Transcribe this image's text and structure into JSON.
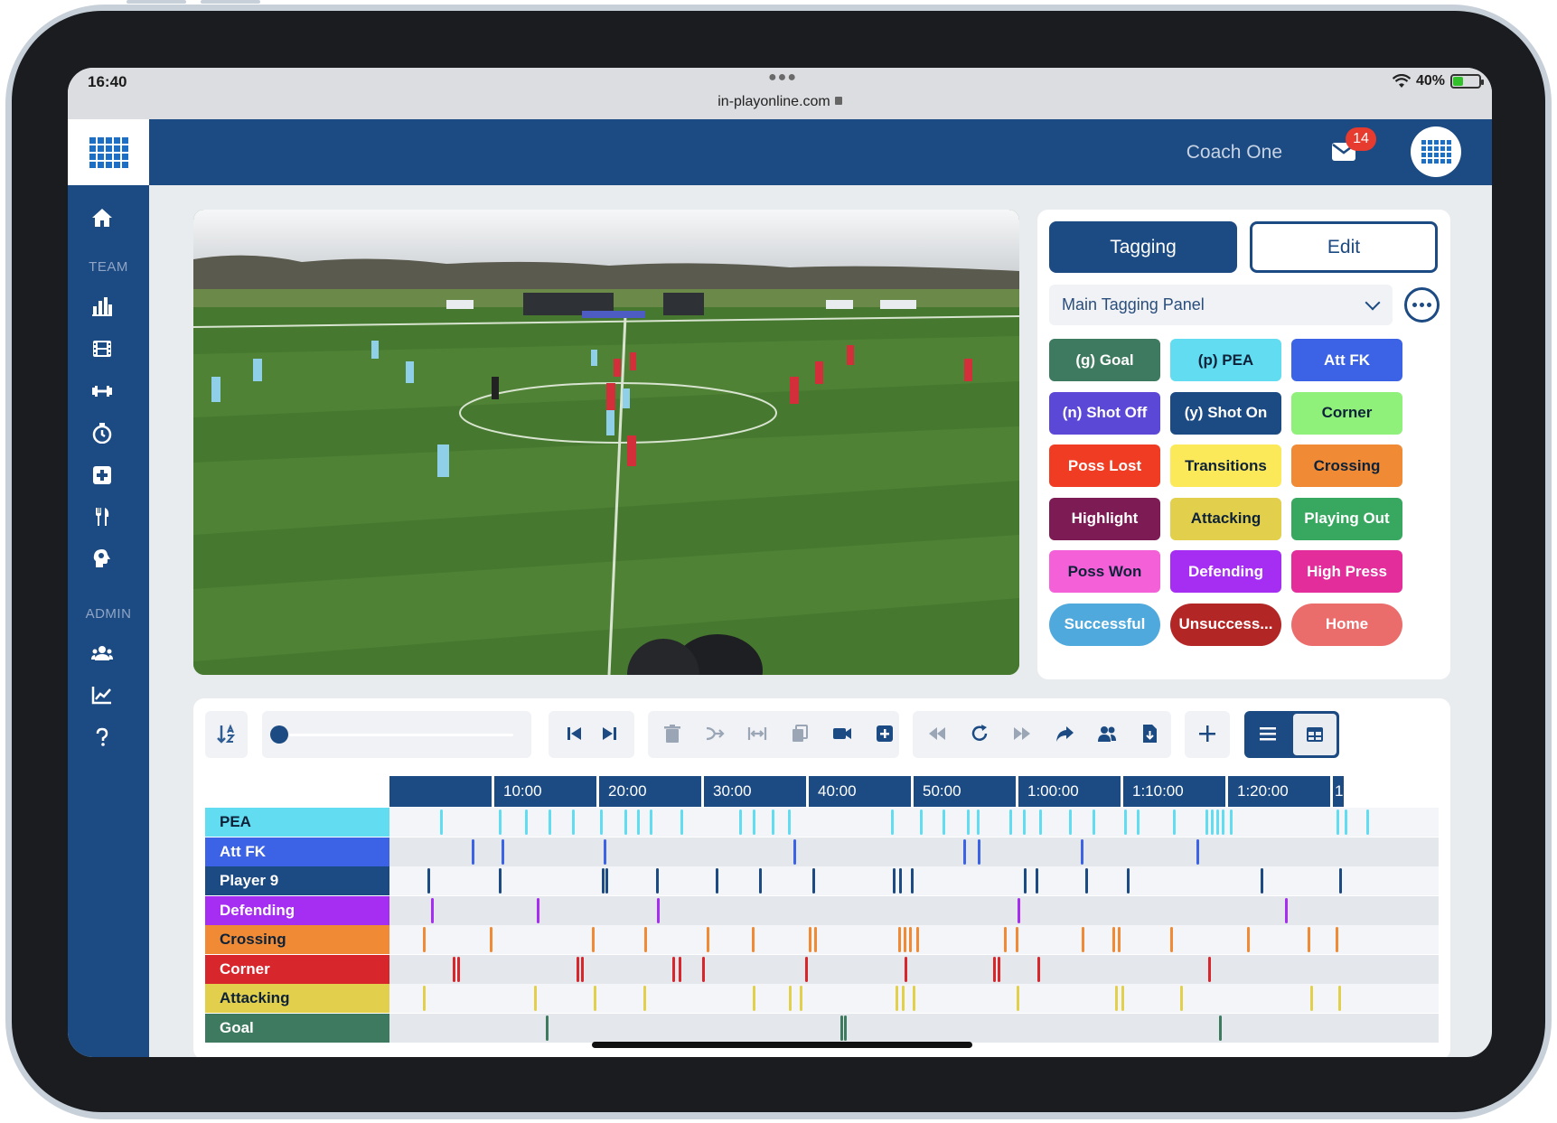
{
  "status_bar": {
    "time": "16:40",
    "url": "in-playonline.com",
    "battery": "40%",
    "battery_level": 0.4
  },
  "header": {
    "user_name": "Coach One",
    "notification_count": "14"
  },
  "sidebar": {
    "team_label": "TEAM",
    "admin_label": "ADMIN",
    "team_icons": [
      "home-icon",
      "bar-chart-icon",
      "film-icon",
      "dumbbell-icon",
      "stopwatch-icon",
      "medical-cross-icon",
      "fork-knife-icon",
      "brain-icon"
    ],
    "admin_icons": [
      "users-icon",
      "line-chart-icon",
      "help-icon"
    ]
  },
  "tagging": {
    "tagging_tab": "Tagging",
    "edit_tab": "Edit",
    "panel_name": "Main Tagging Panel",
    "buttons": [
      {
        "label": "(g) Goal",
        "color": "#3d7a5f",
        "text": "#ffffff"
      },
      {
        "label": "(p) PEA",
        "color": "#62dcf1",
        "text": "#0d2238"
      },
      {
        "label": "Att FK",
        "color": "#3c63e6",
        "text": "#ffffff"
      },
      {
        "label": "(n) Shot Off",
        "color": "#5b48d6",
        "text": "#ffffff"
      },
      {
        "label": "(y) Shot On",
        "color": "#1c4a82",
        "text": "#ffffff"
      },
      {
        "label": "Corner",
        "color": "#8ff07a",
        "text": "#0d2238"
      },
      {
        "label": "Poss Lost",
        "color": "#ef3c22",
        "text": "#ffffff"
      },
      {
        "label": "Transitions",
        "color": "#fbe95a",
        "text": "#0d2238"
      },
      {
        "label": "Crossing",
        "color": "#f08a35",
        "text": "#0d2238"
      },
      {
        "label": "Highlight",
        "color": "#7d1b55",
        "text": "#ffffff"
      },
      {
        "label": "Attacking",
        "color": "#e2cf4c",
        "text": "#0d2238"
      },
      {
        "label": "Playing Out",
        "color": "#38a860",
        "text": "#ffffff"
      },
      {
        "label": "Poss Won",
        "color": "#f460d8",
        "text": "#0d2238"
      },
      {
        "label": "Defending",
        "color": "#a52ef2",
        "text": "#ffffff"
      },
      {
        "label": "High Press",
        "color": "#e22d9a",
        "text": "#ffffff"
      },
      {
        "label": "Successful",
        "color": "#4fa9dc",
        "text": "#ffffff",
        "pill": true
      },
      {
        "label": "Unsuccess...",
        "color": "#b32626",
        "text": "#ffffff",
        "pill": true
      },
      {
        "label": "Home",
        "color": "#ea6d6b",
        "text": "#ffffff",
        "pill": true
      }
    ]
  },
  "toolbar": {
    "progress": 0,
    "icons": [
      "sort-icon",
      "skip-back-icon",
      "skip-forward-icon",
      "trash-icon",
      "merge-icon",
      "expand-icon",
      "copy-icon",
      "video-camera-icon",
      "add-square-icon",
      "rewind-icon",
      "replay-icon",
      "fast-forward-icon",
      "share-icon",
      "users-icon",
      "export-icon",
      "plus-icon",
      "list-view-icon",
      "grid-view-icon"
    ]
  },
  "timeline": {
    "ruler": [
      "",
      "10:00",
      "20:00",
      "30:00",
      "40:00",
      "50:00",
      "1:00:00",
      "1:10:00",
      "1:20:00",
      "1"
    ],
    "rows": [
      {
        "label": "PEA",
        "color": "#62dcf1",
        "text": "#0d2238",
        "marks": [
          4.8,
          10.4,
          12.9,
          15.2,
          17.4,
          20.1,
          22.4,
          23.6,
          24.8,
          27.7,
          33.3,
          34.6,
          36.4,
          38.0,
          47.8,
          50.6,
          52.7,
          55.0,
          56.0,
          59.1,
          60.4,
          61.9,
          64.8,
          67.0,
          70.0,
          71.2,
          74.7,
          77.8,
          78.3,
          78.8,
          79.3,
          80.1,
          90.3,
          91.0,
          93.1
        ]
      },
      {
        "label": "Att FK",
        "color": "#3c63e6",
        "text": "#ffffff",
        "marks": [
          7.8,
          10.7,
          20.4,
          38.5,
          54.7,
          56.1,
          65.9,
          76.9
        ]
      },
      {
        "label": "Player 9",
        "color": "#1c4a82",
        "text": "#ffffff",
        "marks": [
          3.6,
          10.4,
          20.2,
          20.6,
          25.4,
          31.1,
          35.2,
          40.3,
          48.0,
          48.6,
          49.7,
          60.5,
          61.6,
          66.3,
          70.3,
          83.0,
          90.5
        ]
      },
      {
        "label": "Defending",
        "color": "#a52ef2",
        "text": "#ffffff",
        "marks": [
          4.0,
          14.0,
          25.5,
          59.9,
          85.4
        ]
      },
      {
        "label": "Crossing",
        "color": "#f08a35",
        "text": "#0d2238",
        "marks": [
          3.2,
          9.6,
          19.3,
          24.3,
          30.2,
          34.5,
          40.0,
          40.5,
          48.5,
          49.0,
          49.5,
          50.2,
          58.6,
          59.7,
          66.0,
          68.9,
          69.4,
          74.4,
          81.7,
          87.5,
          90.2
        ]
      },
      {
        "label": "Corner",
        "color": "#d8262d",
        "text": "#ffffff",
        "marks": [
          6.0,
          6.5,
          17.8,
          18.3,
          27.0,
          27.6,
          29.8,
          39.6,
          49.1,
          57.5,
          58.0,
          61.8,
          78.0
        ]
      },
      {
        "label": "Attacking",
        "color": "#e2cf4c",
        "text": "#0d2238",
        "marks": [
          3.2,
          13.8,
          19.5,
          24.2,
          34.6,
          38.1,
          39.1,
          48.2,
          48.8,
          49.9,
          59.8,
          69.2,
          69.8,
          75.4,
          87.8,
          90.4
        ]
      },
      {
        "label": "Goal",
        "color": "#3d7a5f",
        "text": "#ffffff",
        "marks": [
          14.9,
          43.0,
          43.3,
          79.1
        ]
      }
    ]
  }
}
